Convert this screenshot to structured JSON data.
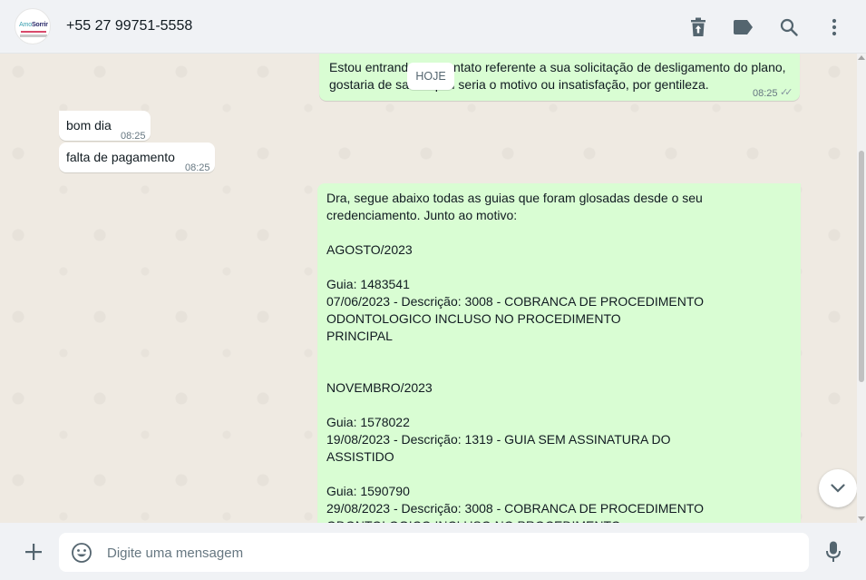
{
  "header": {
    "logo_text_a": "Amo",
    "logo_text_b": "Sorrir",
    "contact_name": "+55 27 99751-5558"
  },
  "chat": {
    "date_chip": "HOJE",
    "messages": [
      {
        "direction": "outgoing",
        "text": "Estou entrando em contato referente a sua solicitação de desligamento do plano,\ngostaria de saber qual seria o motivo ou insatisfação, por gentileza.",
        "time": "08:25",
        "status": "read"
      },
      {
        "direction": "incoming",
        "text": "bom dia",
        "time": "08:25"
      },
      {
        "direction": "incoming",
        "text": "falta de pagamento",
        "time": "08:25"
      },
      {
        "direction": "outgoing",
        "text": "Dra, segue abaixo todas as guias que foram glosadas desde o seu\ncredenciamento. Junto ao motivo:\n\nAGOSTO/2023\n\nGuia: 1483541\n07/06/2023 - Descrição: 3008 - COBRANCA DE PROCEDIMENTO\nODONTOLOGICO INCLUSO NO PROCEDIMENTO\nPRINCIPAL\n\n\nNOVEMBRO/2023\n\nGuia: 1578022\n19/08/2023 - Descrição: 1319 - GUIA SEM ASSINATURA DO\nASSISTIDO\n\nGuia: 1590790\n29/08/2023 - Descrição: 3008 - COBRANCA DE PROCEDIMENTO\nODONTOLOGICO INCLUSO NO PROCEDIMENTO"
      }
    ]
  },
  "composer": {
    "placeholder": "Digite uma mensagem"
  },
  "icons": {
    "header": [
      "delete-icon",
      "label-icon",
      "search-icon",
      "menu-icon"
    ],
    "footer": [
      "plus-icon",
      "emoji-icon",
      "mic-icon"
    ],
    "chat": [
      "chevron-down-icon"
    ]
  },
  "colors": {
    "outgoing_bubble": "#d9fdd3",
    "incoming_bubble": "#ffffff",
    "chat_background": "#efeae2",
    "header_background": "#f0f2f5",
    "icon": "#54656f"
  }
}
